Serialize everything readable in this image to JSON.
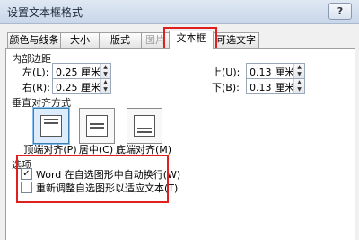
{
  "window": {
    "title": "设置文本框格式",
    "help_button": "?"
  },
  "tabs": [
    {
      "label": "颜色与线条",
      "state": "normal"
    },
    {
      "label": "大小",
      "state": "normal"
    },
    {
      "label": "版式",
      "state": "normal"
    },
    {
      "label": "图片",
      "state": "disabled"
    },
    {
      "label": "文本框",
      "state": "active"
    },
    {
      "label": "可选文字",
      "state": "normal"
    }
  ],
  "margins": {
    "section_title": "内部边距",
    "left": {
      "label": "左(L):",
      "value": "0.25 厘米"
    },
    "right": {
      "label": "右(R):",
      "value": "0.25 厘米"
    },
    "top": {
      "label": "上(U):",
      "value": "0.13 厘米"
    },
    "bottom": {
      "label": "下(B):",
      "value": "0.13 厘米"
    }
  },
  "valign": {
    "section_title": "垂直对齐方式",
    "options": [
      {
        "label": "顶端对齐(P)",
        "selected": true
      },
      {
        "label": "居中(C)",
        "selected": false
      },
      {
        "label": "底端对齐(M)",
        "selected": false
      }
    ]
  },
  "options": {
    "section_title": "选项",
    "wrap": {
      "label": "Word 在自选图形中自动换行(W)",
      "checked": true
    },
    "resize": {
      "label": "重新调整自选图形以适应文本(T)",
      "checked": false
    }
  },
  "colors": {
    "highlight": "#e0201e",
    "selected_fill": "#dcecfc"
  }
}
